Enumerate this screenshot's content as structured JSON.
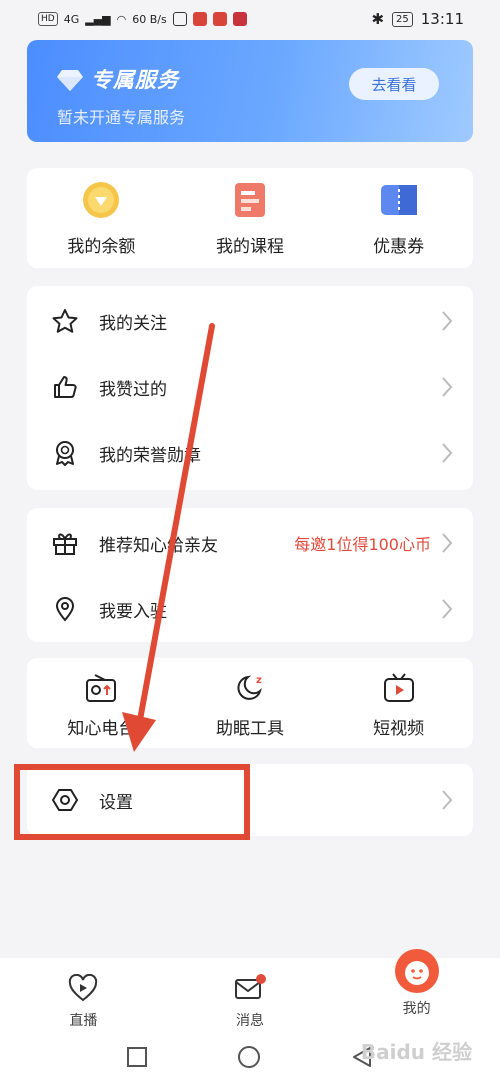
{
  "status_bar": {
    "left": [
      "HD",
      "4G",
      "60 B/s"
    ],
    "battery": "25",
    "time": "13:11"
  },
  "banner": {
    "title": "专属服务",
    "subtitle": "暂未开通专属服务",
    "button": "去看看",
    "icon": "diamond-icon"
  },
  "quick_grid": [
    {
      "label": "我的余额",
      "icon": "coin-icon"
    },
    {
      "label": "我的课程",
      "icon": "course-icon"
    },
    {
      "label": "优惠券",
      "icon": "coupon-icon"
    }
  ],
  "menu1": [
    {
      "label": "我的关注",
      "icon": "star-icon"
    },
    {
      "label": "我赞过的",
      "icon": "thumbs-up-icon"
    },
    {
      "label": "我的荣誉勋章",
      "icon": "medal-icon"
    }
  ],
  "menu2": [
    {
      "label": "推荐知心给亲友",
      "hint": "每邀1位得100心币",
      "icon": "gift-icon"
    },
    {
      "label": "我要入驻",
      "icon": "location-pin-icon"
    }
  ],
  "tools_grid": [
    {
      "label": "知心电台",
      "icon": "radio-icon"
    },
    {
      "label": "助眠工具",
      "icon": "moon-sleep-icon"
    },
    {
      "label": "短视频",
      "icon": "tv-icon"
    }
  ],
  "settings": {
    "label": "设置",
    "icon": "hexagon-settings-icon"
  },
  "tabbar": [
    {
      "label": "直播",
      "icon": "heart-play-icon"
    },
    {
      "label": "消息",
      "icon": "mail-icon"
    },
    {
      "label": "我的",
      "icon": "profile-icon"
    }
  ],
  "watermark": "Baidu 经验",
  "colors": {
    "accent": "#4c8dff",
    "red": "#e14b3c",
    "annotation": "#e04a35"
  }
}
